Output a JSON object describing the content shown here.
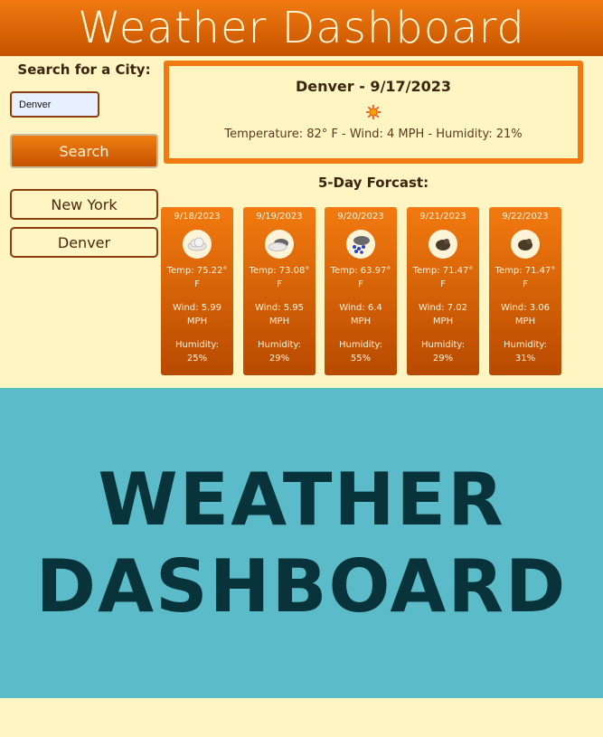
{
  "header": {
    "title": "Weather Dashboard"
  },
  "search": {
    "label": "Search for a City:",
    "input_value": "Denver",
    "button_label": "Search"
  },
  "history": [
    {
      "label": "New York"
    },
    {
      "label": "Denver"
    }
  ],
  "current": {
    "title": "Denver - 9/17/2023",
    "icon": "sunny-icon",
    "stats": "Temperature: 82° F - Wind: 4 MPH - Humidity: 21%"
  },
  "forecast_title": "5-Day Forcast:",
  "forecast": [
    {
      "date": "9/18/2023",
      "icon": "cloud-icon",
      "temp": "Temp: 75.22°",
      "temp_unit": "F",
      "wind": "Wind: 5.99",
      "wind_unit": "MPH",
      "hum": "Humidity:",
      "hum_val": "25%"
    },
    {
      "date": "9/19/2023",
      "icon": "partly-cloudy-icon",
      "temp": "Temp: 73.08°",
      "temp_unit": "F",
      "wind": "Wind: 5.95",
      "wind_unit": "MPH",
      "hum": "Humidity:",
      "hum_val": "29%"
    },
    {
      "date": "9/20/2023",
      "icon": "rain-icon",
      "temp": "Temp: 63.97°",
      "temp_unit": "F",
      "wind": "Wind: 6.4",
      "wind_unit": "MPH",
      "hum": "Humidity:",
      "hum_val": "55%"
    },
    {
      "date": "9/21/2023",
      "icon": "broken-clouds-icon",
      "temp": "Temp: 71.47°",
      "temp_unit": "F",
      "wind": "Wind: 7.02",
      "wind_unit": "MPH",
      "hum": "Humidity:",
      "hum_val": "29%"
    },
    {
      "date": "9/22/2023",
      "icon": "broken-clouds-icon",
      "temp": "Temp: 71.47°",
      "temp_unit": "F",
      "wind": "Wind: 3.06",
      "wind_unit": "MPH",
      "hum": "Humidity:",
      "hum_val": "31%"
    }
  ],
  "banner": {
    "line1": "WEATHER",
    "line2": "DASHBOARD"
  },
  "colors": {
    "accent": "#f07a10",
    "background": "#fff5c2",
    "banner": "#5bbbc8",
    "banner_text": "#08333b"
  }
}
